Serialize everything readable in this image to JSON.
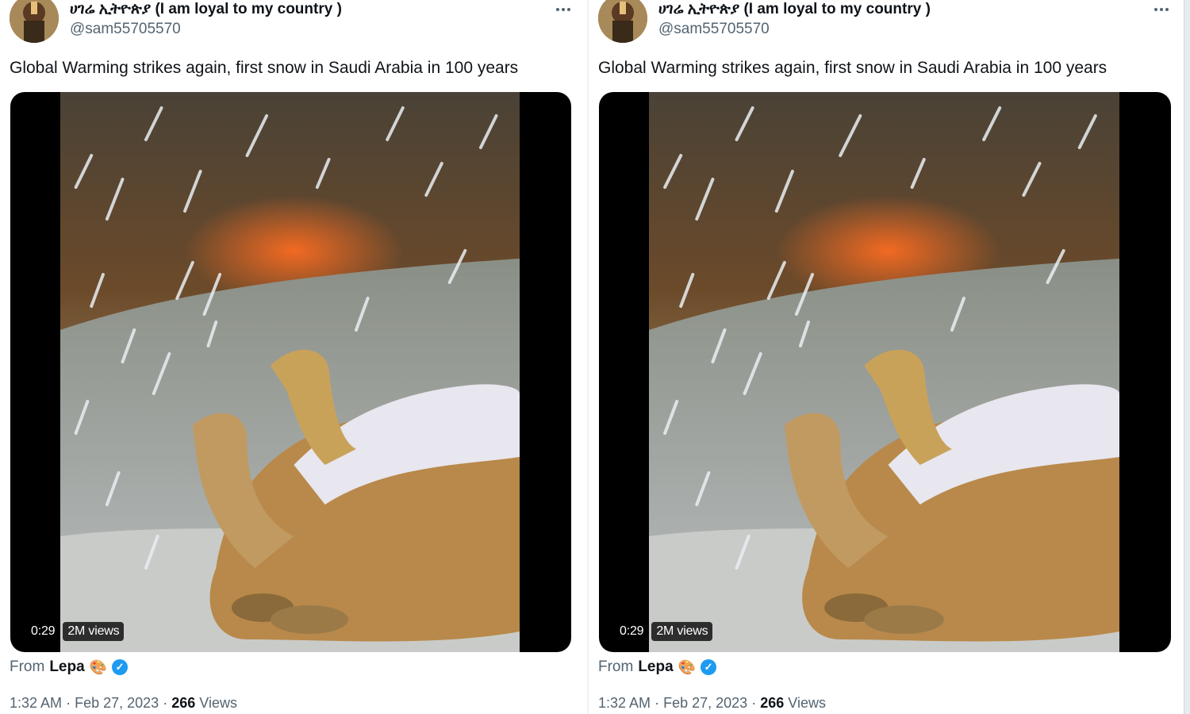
{
  "tweets": [
    {
      "author_name": "ሀገሬ ኢትዮጵያ (I am loyal to my country )",
      "handle": "@sam55705570",
      "text": "Global Warming strikes again, first snow in Saudi Arabia in 100 years",
      "video": {
        "duration": "0:29",
        "views_badge": "2M views"
      },
      "source": {
        "prefix": "From",
        "name": "Lepa",
        "emoji": "🎨",
        "verified_symbol": "✓"
      },
      "time": "1:32 AM",
      "separator": "·",
      "date": "Feb 27, 2023",
      "views_count": "266",
      "views_label": "Views",
      "icons": [
        "more-icon",
        "palette-icon",
        "verified-badge-icon"
      ]
    },
    {
      "author_name": "ሀገሬ ኢትዮጵያ (I am loyal to my country )",
      "handle": "@sam55705570",
      "text": "Global Warming strikes again, first snow in Saudi Arabia in 100 years",
      "video": {
        "duration": "0:29",
        "views_badge": "2M views"
      },
      "source": {
        "prefix": "From",
        "name": "Lepa",
        "emoji": "🎨",
        "verified_symbol": "✓"
      },
      "time": "1:32 AM",
      "separator": "·",
      "date": "Feb 27, 2023",
      "views_count": "266",
      "views_label": "Views",
      "icons": [
        "more-icon",
        "palette-icon",
        "verified-badge-icon"
      ]
    }
  ],
  "colors": {
    "accent": "#1d9bf0",
    "text": "#0f1419",
    "secondary": "#536471"
  }
}
